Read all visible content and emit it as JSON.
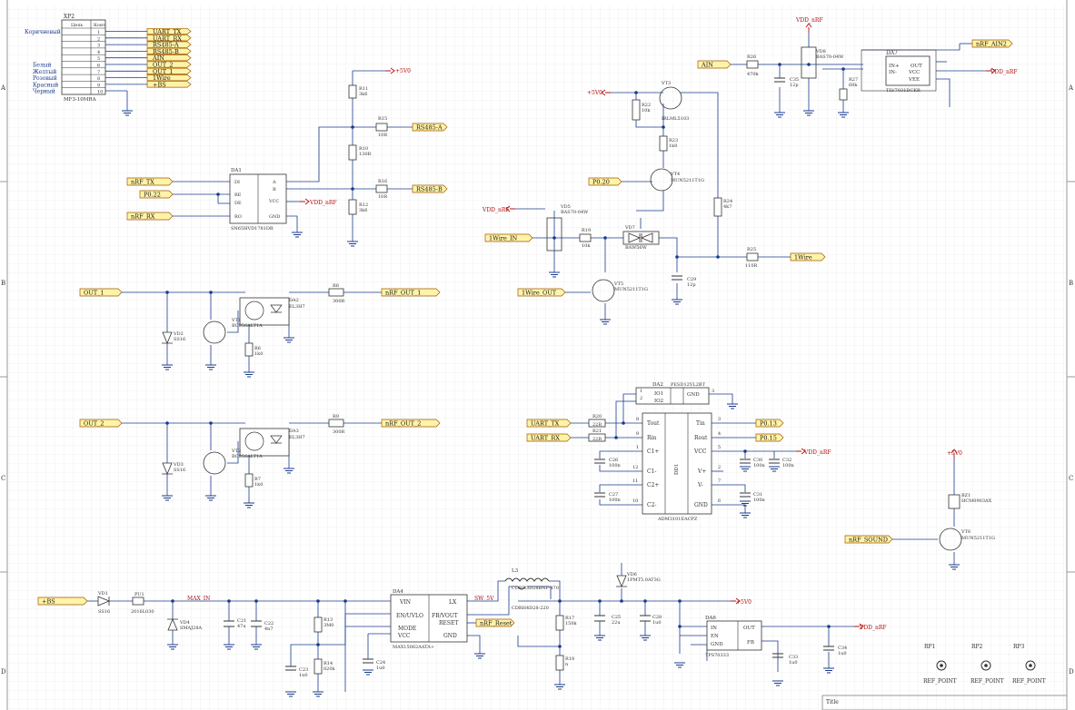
{
  "frame": {
    "rows": [
      "A",
      "B",
      "C",
      "D"
    ],
    "title_label": "Title"
  },
  "connector": {
    "ref": "XP2",
    "part": "MF3-10MRA",
    "header_name": "Цепь",
    "header_pin": "Конт",
    "pins": [
      {
        "num": "1",
        "net": "UART_TX",
        "color": ""
      },
      {
        "num": "2",
        "net": "UART_RX",
        "color": ""
      },
      {
        "num": "3",
        "net": "RS485-A",
        "color": ""
      },
      {
        "num": "4",
        "net": "RS485-B",
        "color": ""
      },
      {
        "num": "5",
        "net": "AIN",
        "color": ""
      },
      {
        "num": "6",
        "net": "OUT_2",
        "color": "Белый"
      },
      {
        "num": "7",
        "net": "OUT_1",
        "color": "Желтый"
      },
      {
        "num": "8",
        "net": "1Wire",
        "color": "Розовый"
      },
      {
        "num": "9",
        "net": "+BS",
        "color": "Красный"
      },
      {
        "num": "10",
        "net": "",
        "color": "Черный"
      }
    ],
    "top_color": "Коричневый"
  },
  "ports": {
    "nrf_tx": "nRF_TX",
    "p022": "P0.22",
    "nrf_rx": "nRF_RX",
    "rs485a": "RS485-A",
    "rs485b": "RS485-B",
    "out1": "OUT_1",
    "out2": "OUT_2",
    "nrf_out1": "nRF_OUT_1",
    "nrf_out2": "nRF_OUT_2",
    "ain": "AIN",
    "nrf_ain2": "nRF_AIN2",
    "p020": "P0.20",
    "onewire_in": "1Wire_IN",
    "onewire_out": "1Wire_OUT",
    "onewire": "1Wire",
    "uart_tx": "UART_TX",
    "uart_rx": "UART_RX",
    "p013": "P0.13",
    "p015": "P0.15",
    "nrf_sound": "nRF_SOUND",
    "bs": "+BS",
    "nrf_reset": "nRF_Reset"
  },
  "power": {
    "p5v0": "+5V0",
    "vdd_nrf": "VDD_nRF",
    "max_in": "MAX_IN",
    "v5v": "+5V0",
    "sw5v": "SW_5V"
  },
  "components": {
    "r11": [
      "R11",
      "3k6"
    ],
    "r15": [
      "R15",
      "10R"
    ],
    "r10": [
      "R10",
      "130R"
    ],
    "r16": [
      "R16",
      "10R"
    ],
    "r12": [
      "R12",
      "3k6"
    ],
    "da1": [
      "DA1",
      "SN65HVD1781DR"
    ],
    "da1_pins": [
      "DI",
      "RE",
      "DE",
      "RO",
      "A",
      "B",
      "VCC",
      "GND"
    ],
    "r8": [
      "R8",
      "300R"
    ],
    "da2": [
      "DA2",
      "EL3H7"
    ],
    "vt1": [
      "VT1",
      "BC856ALT1A"
    ],
    "vd2": [
      "VD2",
      "SS16"
    ],
    "r6": [
      "R6",
      "1k0"
    ],
    "r9": [
      "R9",
      "300R"
    ],
    "da3": [
      "DA3",
      "EL3H7"
    ],
    "vt2": [
      "VT2",
      "BC856ALT1A"
    ],
    "vd3": [
      "VD3",
      "SS16"
    ],
    "r7": [
      "R7",
      "1k0"
    ],
    "r26": [
      "R26",
      "470k"
    ],
    "c35": [
      "C35",
      "12p"
    ],
    "vd8": [
      "VD8",
      "BAS70-04W"
    ],
    "r27": [
      "R27",
      "68k"
    ],
    "da7": [
      "DA7",
      "TLV7031DCKR"
    ],
    "da7_pins": [
      "IN+",
      "IN-",
      "OUT",
      "VCC",
      "VEE"
    ],
    "vt3": [
      "VT3",
      "IRLML5103"
    ],
    "r22": [
      "R22",
      "10k"
    ],
    "r23": [
      "R23",
      "1k0"
    ],
    "vt4": [
      "VT4",
      "MUN5211T1G"
    ],
    "r24": [
      "R24",
      "4k7"
    ],
    "vd5": [
      "VD5",
      "BAS70-04W"
    ],
    "r19": [
      "R19",
      "10k"
    ],
    "vd7": [
      "VD7",
      "BAW56W"
    ],
    "r25": [
      "R25",
      "110R"
    ],
    "c29": [
      "C29",
      "12p"
    ],
    "vt5": [
      "VT5",
      "MUN5211T1G"
    ],
    "da2b": [
      "DA2",
      "PESD12VL2BT"
    ],
    "dd1": [
      "DD1",
      "ADM3101EACPZ"
    ],
    "dd1_pins": [
      "Tout",
      "Rin",
      "C1+",
      "C1-",
      "C2+",
      "C2-",
      "Tin",
      "Rout",
      "VCC",
      "V+",
      "V-",
      "GND"
    ],
    "r20": [
      "R20",
      "22R"
    ],
    "r21": [
      "R21",
      "22R"
    ],
    "c26": [
      "C26",
      "100n"
    ],
    "c27": [
      "C27",
      "100n"
    ],
    "c30": [
      "C30",
      "100n"
    ],
    "c32": [
      "C32",
      "100n"
    ],
    "c31": [
      "C31",
      "100n"
    ],
    "bz1": [
      "BZ1",
      "HCM0903AX"
    ],
    "vt6": [
      "VT6",
      "MUN5211T1G"
    ],
    "vd1": [
      "VD1",
      "SS16"
    ],
    "pu1": [
      "PU1",
      "2016L030"
    ],
    "vd4": [
      "VD4",
      "SMAJ28A"
    ],
    "c21": [
      "C21",
      "47u"
    ],
    "c22": [
      "C22",
      "4n7"
    ],
    "r13": [
      "R13",
      "3M0"
    ],
    "r14": [
      "R14",
      "820k"
    ],
    "c23": [
      "C23",
      "1n0"
    ],
    "c24": [
      "C24",
      "1u0"
    ],
    "da4": [
      "DA4",
      "MAX15062AATA+"
    ],
    "da4_pins": [
      "VIN",
      "EN/UVLO",
      "MODE",
      "VCC",
      "LX",
      "FB/VOUT",
      "RESET",
      "GND"
    ],
    "l3": [
      "L3",
      "CDRH3D28BNP-470"
    ],
    "l3b": "CDRH4D28-220",
    "vd6": [
      "VD6",
      "1PMT5.0AT3G"
    ],
    "r17": [
      "R17",
      "150k"
    ],
    "r18": [
      "R18",
      "n"
    ],
    "c25": [
      "C25",
      "22u"
    ],
    "c28": [
      "C28",
      "1u0"
    ],
    "da6": [
      "DA6",
      "TPS70333"
    ],
    "da6_pins": [
      "IN",
      "EN",
      "GND",
      "OUT",
      "FB"
    ],
    "c33": [
      "C33",
      "1u0"
    ],
    "c34": [
      "C34",
      "1u0"
    ],
    "rp1": [
      "RP1",
      "REF_POINT"
    ],
    "rp2": [
      "RP2",
      "REF_POINT"
    ],
    "rp3": [
      "RP3",
      "REF_POINT"
    ]
  }
}
